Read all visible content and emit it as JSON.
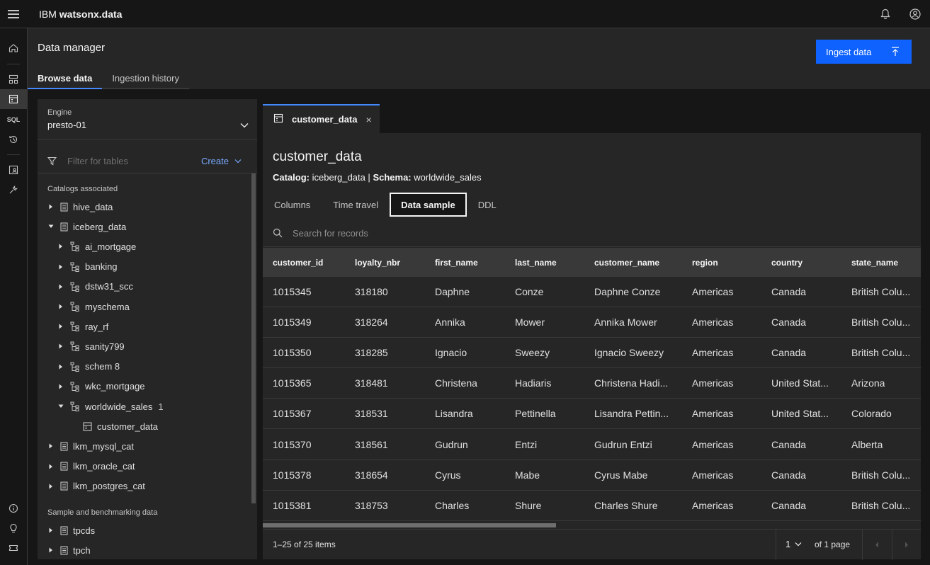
{
  "header": {
    "brand_prefix": "IBM",
    "brand_name": "watsonx.data",
    "icons": [
      "menu-icon",
      "notification-icon",
      "user-avatar-icon"
    ]
  },
  "rail": {
    "items": [
      "home-icon",
      "infrastructure-icon",
      "data-manager-icon",
      "sql-icon",
      "query-history-icon",
      "access-control-icon",
      "configurations-icon",
      "info-icon",
      "lightbulb-icon",
      "ticket-icon"
    ],
    "sql_label": "SQL"
  },
  "page": {
    "title": "Data manager",
    "ingest_button": "Ingest data",
    "tabs": [
      "Browse data",
      "Ingestion history"
    ]
  },
  "left": {
    "engine_label": "Engine",
    "engine_value": "presto-01",
    "filter_placeholder": "Filter for tables",
    "create_label": "Create",
    "catalogs_label": "Catalogs associated",
    "sample_label": "Sample and benchmarking data",
    "tree": [
      {
        "label": "hive_data",
        "expanded": false,
        "type": "catalog"
      },
      {
        "label": "iceberg_data",
        "expanded": true,
        "type": "catalog"
      },
      {
        "label": "ai_mortgage",
        "expanded": false,
        "type": "schema"
      },
      {
        "label": "banking",
        "expanded": false,
        "type": "schema"
      },
      {
        "label": "dstw31_scc",
        "expanded": false,
        "type": "schema"
      },
      {
        "label": "myschema",
        "expanded": false,
        "type": "schema"
      },
      {
        "label": "ray_rf",
        "expanded": false,
        "type": "schema"
      },
      {
        "label": "sanity799",
        "expanded": false,
        "type": "schema"
      },
      {
        "label": "schem 8",
        "expanded": false,
        "type": "schema"
      },
      {
        "label": "wkc_mortgage",
        "expanded": false,
        "type": "schema"
      },
      {
        "label": "worldwide_sales",
        "expanded": true,
        "type": "schema",
        "count": "1"
      },
      {
        "label": "customer_data",
        "type": "table"
      },
      {
        "label": "lkm_mysql_cat",
        "expanded": false,
        "type": "catalog"
      },
      {
        "label": "lkm_oracle_cat",
        "expanded": false,
        "type": "catalog"
      },
      {
        "label": "lkm_postgres_cat",
        "expanded": false,
        "type": "catalog"
      }
    ],
    "sample_tree": [
      {
        "label": "tpcds",
        "expanded": false,
        "type": "catalog"
      },
      {
        "label": "tpch",
        "expanded": false,
        "type": "catalog"
      }
    ]
  },
  "right": {
    "open_tab": "customer_data",
    "close_glyph": "×",
    "table_title": "customer_data",
    "catalog_label": "Catalog:",
    "catalog_value": "iceberg_data",
    "meta_sep": "|",
    "schema_label": "Schema:",
    "schema_value": "worldwide_sales",
    "sub_tabs": [
      "Columns",
      "Time travel",
      "Data sample",
      "DDL"
    ],
    "active_sub_tab": "Data sample",
    "search_placeholder": "Search for records",
    "columns": [
      "customer_id",
      "loyalty_nbr",
      "first_name",
      "last_name",
      "customer_name",
      "region",
      "country",
      "state_name"
    ],
    "rows": [
      [
        "1015345",
        "318180",
        "Daphne",
        "Conze",
        "Daphne Conze",
        "Americas",
        "Canada",
        "British Colu..."
      ],
      [
        "1015349",
        "318264",
        "Annika",
        "Mower",
        "Annika Mower",
        "Americas",
        "Canada",
        "British Colu..."
      ],
      [
        "1015350",
        "318285",
        "Ignacio",
        "Sweezy",
        "Ignacio Sweezy",
        "Americas",
        "Canada",
        "British Colu..."
      ],
      [
        "1015365",
        "318481",
        "Christena",
        "Hadiaris",
        "Christena Hadi...",
        "Americas",
        "United Stat...",
        "Arizona"
      ],
      [
        "1015367",
        "318531",
        "Lisandra",
        "Pettinella",
        "Lisandra Pettin...",
        "Americas",
        "United Stat...",
        "Colorado"
      ],
      [
        "1015370",
        "318561",
        "Gudrun",
        "Entzi",
        "Gudrun Entzi",
        "Americas",
        "Canada",
        "Alberta"
      ],
      [
        "1015378",
        "318654",
        "Cyrus",
        "Mabe",
        "Cyrus Mabe",
        "Americas",
        "Canada",
        "British Colu..."
      ],
      [
        "1015381",
        "318753",
        "Charles",
        "Shure",
        "Charles Shure",
        "Americas",
        "Canada",
        "British Colu..."
      ]
    ],
    "pager": {
      "items_text": "1–25 of 25 items",
      "page_value": "1",
      "of_text": "of 1 page"
    }
  },
  "colors": {
    "accent": "#0f62fe",
    "link": "#78a9ff",
    "tab_indicator": "#4589ff",
    "background": "#161616",
    "surface": "#262626"
  }
}
